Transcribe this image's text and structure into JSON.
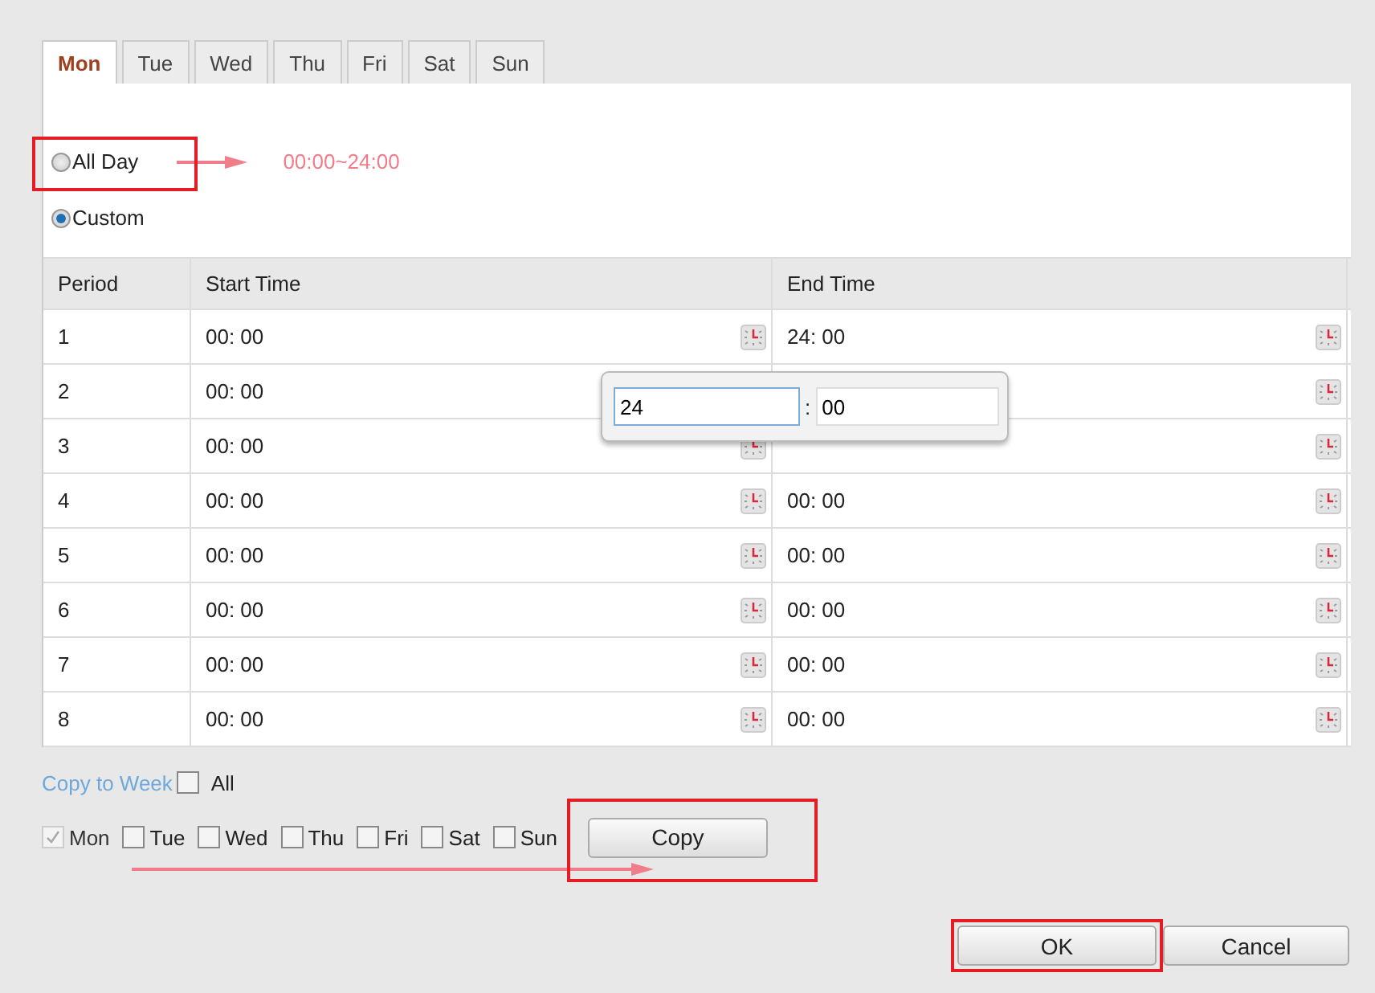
{
  "tabs": [
    {
      "label": "Mon",
      "selected": true
    },
    {
      "label": "Tue",
      "selected": false
    },
    {
      "label": "Wed",
      "selected": false
    },
    {
      "label": "Thu",
      "selected": false
    },
    {
      "label": "Fri",
      "selected": false
    },
    {
      "label": "Sat",
      "selected": false
    },
    {
      "label": "Sun",
      "selected": false
    }
  ],
  "mode_options": [
    {
      "label": "All Day",
      "selected": false,
      "highlighted": true,
      "note": "00:00~24:00"
    },
    {
      "label": "Custom",
      "selected": true,
      "highlighted": false
    }
  ],
  "table": {
    "columns": [
      "Period",
      "Start Time",
      "End Time"
    ],
    "rows": [
      {
        "period": "1",
        "start": "00: 00",
        "end": "24: 00"
      },
      {
        "period": "2",
        "start": "00: 00"
      },
      {
        "period": "3",
        "start": "00: 00"
      },
      {
        "period": "4",
        "start": "00: 00",
        "end": "00: 00"
      },
      {
        "period": "5",
        "start": "00: 00",
        "end": "00: 00"
      },
      {
        "period": "6",
        "start": "00: 00",
        "end": "00: 00"
      },
      {
        "period": "7",
        "start": "00: 00",
        "end": "00: 00"
      },
      {
        "period": "8",
        "start": "00: 00",
        "end": "00: 00"
      }
    ]
  },
  "time_popup": {
    "hour": "24",
    "separator": ":",
    "minute": "00"
  },
  "copy_to_week": {
    "label": "Copy to Week",
    "all": {
      "label": "All",
      "checked": false
    },
    "days": [
      {
        "label": "Mon",
        "checked": true,
        "disabled": true
      },
      {
        "label": "Tue",
        "checked": false,
        "disabled": false
      },
      {
        "label": "Wed",
        "checked": false,
        "disabled": false
      },
      {
        "label": "Thu",
        "checked": false,
        "disabled": false
      },
      {
        "label": "Fri",
        "checked": false,
        "disabled": false
      },
      {
        "label": "Sat",
        "checked": false,
        "disabled": false
      },
      {
        "label": "Sun",
        "checked": false,
        "disabled": false
      }
    ],
    "copy_button": {
      "label": "Copy",
      "highlighted": true
    }
  },
  "buttons": [
    {
      "label": "OK",
      "highlighted": true
    },
    {
      "label": "Cancel",
      "highlighted": false
    }
  ]
}
